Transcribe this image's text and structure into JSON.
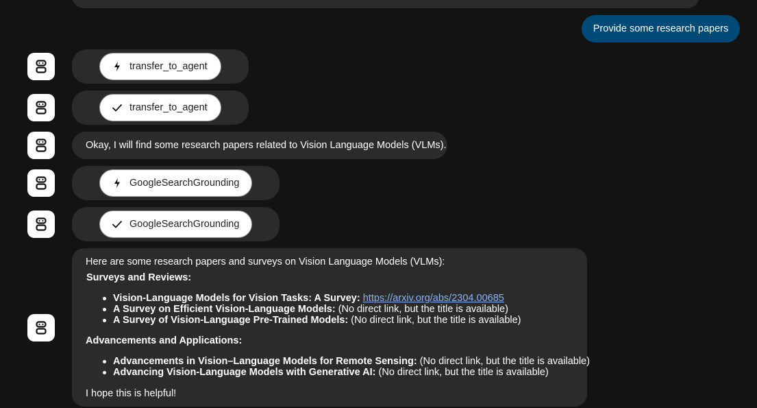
{
  "user_message": "Provide some research papers",
  "messages": {
    "tool_call_1": {
      "icon": "lightning-icon",
      "label": "transfer_to_agent"
    },
    "tool_result_1": {
      "icon": "check-icon",
      "label": "transfer_to_agent"
    },
    "agent_text_1": "Okay, I will find some research papers related to Vision Language Models (VLMs).",
    "tool_call_2": {
      "icon": "lightning-icon",
      "label": "GoogleSearchGrounding"
    },
    "tool_result_2": {
      "icon": "check-icon",
      "label": "GoogleSearchGrounding"
    }
  },
  "answer": {
    "intro": "Here are some research papers and surveys on Vision Language Models (VLMs):",
    "section1": {
      "heading": "Surveys and Reviews:",
      "items": [
        {
          "title": "Vision-Language Models for Vision Tasks: A Survey:",
          "rest": " ",
          "link": "https://arxiv.org/abs/2304.00685"
        },
        {
          "title": "A Survey on Efficient Vision-Language Models:",
          "rest": " (No direct link, but the title is available)"
        },
        {
          "title": "A Survey of Vision-Language Pre-Trained Models:",
          "rest": " (No direct link, but the title is available)"
        }
      ]
    },
    "section2": {
      "heading": "Advancements and Applications:",
      "items": [
        {
          "title": "Advancements in Vision–Language Models for Remote Sensing:",
          "rest": " (No direct link, but the title is available)"
        },
        {
          "title": "Advancing Vision-Language Models with Generative AI:",
          "rest": " (No direct link, but the title is available)"
        }
      ]
    },
    "closing": "I hope this is helpful!"
  },
  "colors": {
    "background": "#131313",
    "bubble": "#2b2b2b",
    "user_bubble": "#004a77",
    "link": "#8ab4f8"
  }
}
